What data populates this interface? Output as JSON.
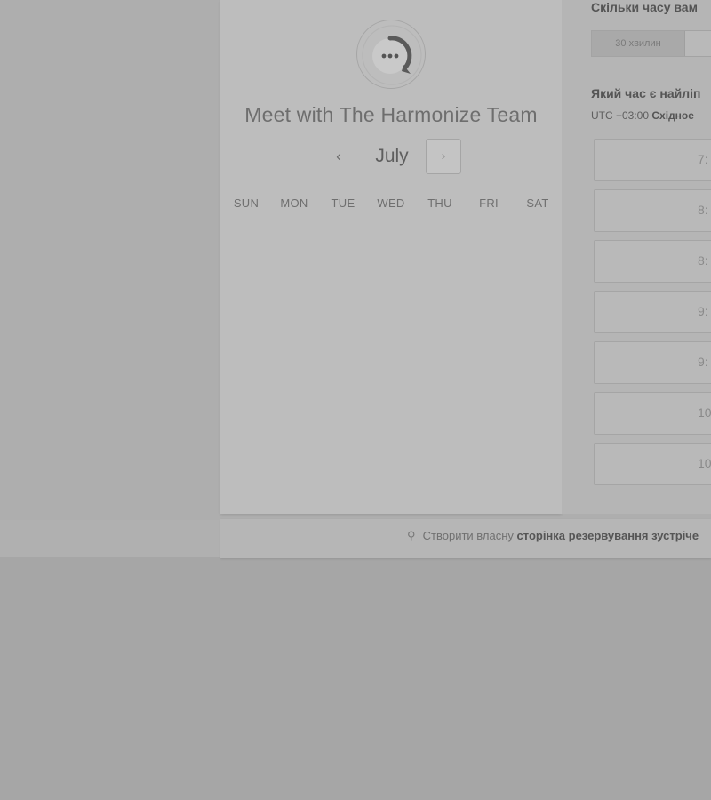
{
  "booking_card": {
    "title": "Meet with The Harmonize Team",
    "logo_icon": "chat-bubble-ellipsis-icon",
    "calendar": {
      "month": "July",
      "prev_icon": "‹",
      "next_icon": "›",
      "weekdays": [
        "SUN",
        "MON",
        "TUE",
        "WED",
        "THU",
        "FRI",
        "SAT"
      ]
    }
  },
  "right_panel": {
    "duration_question": "Скільки часу вам",
    "duration_options": [
      "30 хвилин"
    ],
    "time_question": "Який час є найліп",
    "timezone_offset": "UTC +03:00",
    "timezone_name": "Східное",
    "time_slots": [
      "7:",
      "8:",
      "8:",
      "9:",
      "9:",
      "10",
      "10"
    ]
  },
  "footer": {
    "icon": "magic-wand-icon",
    "prefix": "Створити власну",
    "link": "сторінка резервування зустріче"
  },
  "colors": {
    "overlay_gray": "#aeaeae",
    "card": "#bdbdbd"
  }
}
